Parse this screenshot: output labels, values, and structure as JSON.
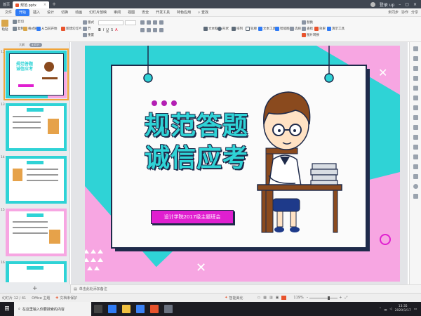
{
  "titlebar": {
    "tabs": [
      {
        "label": "首页",
        "active": false
      },
      {
        "label": "规范.pptx",
        "active": true
      }
    ],
    "user_label": "登录 up"
  },
  "menubar": {
    "items": [
      "文件",
      "开始",
      "插入",
      "设计",
      "切换",
      "动画",
      "幻灯片放映",
      "审阅",
      "视图",
      "安全",
      "开发工具",
      "特色应用",
      "查找"
    ],
    "active_index": 1,
    "right": [
      "未同步",
      "协作",
      "分享"
    ]
  },
  "ribbon": {
    "paste": "粘贴",
    "cut": "剪切",
    "copy": "复制",
    "format_painter": "格式刷",
    "from_current": "从当前开始",
    "new_slide": "新建幻灯片",
    "layout": "版式",
    "section": "节",
    "reset": "重置",
    "text_box": "文本框",
    "shape": "形状",
    "arrange": "排列",
    "outline": "轮廓",
    "text_tool": "文本工具",
    "smart_graphic": "智能图形",
    "select": "选择",
    "replace": "替换",
    "find": "查找",
    "effects": "效果",
    "slide_library": "演示工具",
    "tools": "图片转换"
  },
  "leftpanel": {
    "tabs": [
      "大纲",
      "幻灯片"
    ],
    "active_tab": 1,
    "slide_numbers": [
      "12",
      "13",
      "14",
      "15",
      "16"
    ],
    "thumb1_title_line1": "规范答题",
    "thumb1_title_line2": "诚信应考",
    "add_slide": "+"
  },
  "slide": {
    "title_line1": "规范答题",
    "title_line2": "诚信应考",
    "subtitle": "设计学院2017级主题班会",
    "colors": {
      "teal": "#2fd3d6",
      "pink": "#f7a6e2",
      "magenta": "#e01fd0",
      "navy": "#1e2a4a",
      "purple_dot": "#b31fb3"
    }
  },
  "notes": {
    "placeholder": "单击此处添加备注"
  },
  "statusbar": {
    "slide_info": "幻灯片 12 / 41",
    "theme": "Office 主题",
    "protect": "文档未保护",
    "smart_beautify": "智能美化",
    "zoom": "119%"
  },
  "taskbar": {
    "search_placeholder": "在这里输入你要搜索的内容",
    "time": "13:35",
    "date": "2020/1/17"
  }
}
